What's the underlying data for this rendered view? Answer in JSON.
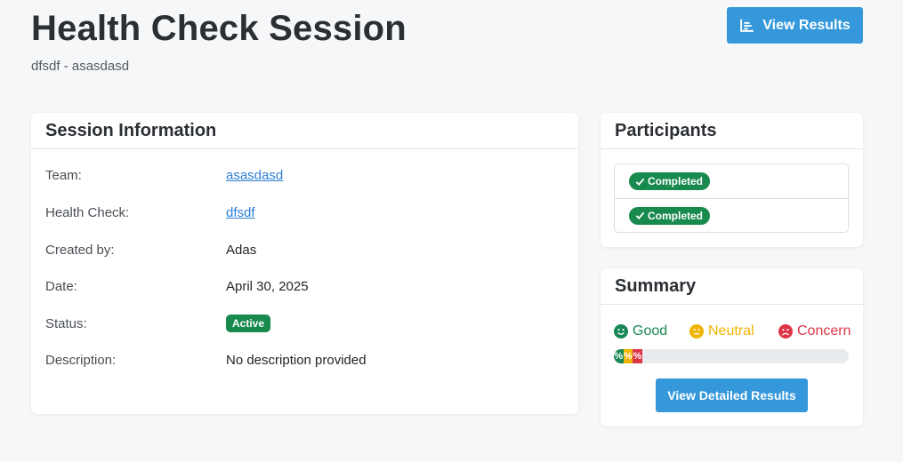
{
  "header": {
    "title": "Health Check Session",
    "subtitle": "dfsdf - asasdasd",
    "view_results_label": "View Results"
  },
  "session_info": {
    "heading": "Session Information",
    "rows": [
      {
        "label": "Team:",
        "value": "asasdasd",
        "type": "link"
      },
      {
        "label": "Health Check:",
        "value": "dfsdf",
        "type": "link"
      },
      {
        "label": "Created by:",
        "value": "Adas",
        "type": "text"
      },
      {
        "label": "Date:",
        "value": "April 30, 2025",
        "type": "text"
      },
      {
        "label": "Status:",
        "value": "Active",
        "type": "badge"
      },
      {
        "label": "Description:",
        "value": "No description provided",
        "type": "text"
      }
    ]
  },
  "participants": {
    "heading": "Participants",
    "items": [
      {
        "status": "Completed"
      },
      {
        "status": "Completed"
      }
    ]
  },
  "summary": {
    "heading": "Summary",
    "legend": [
      {
        "label": "Good",
        "color": "#198754",
        "icon": "smile-icon"
      },
      {
        "label": "Neutral",
        "color": "#f0b400",
        "icon": "neutral-face-icon"
      },
      {
        "label": "Concern",
        "color": "#dc3545",
        "icon": "frown-icon"
      }
    ],
    "progress": [
      {
        "text": "%",
        "color": "#198754",
        "fraction": 0.04
      },
      {
        "text": "%",
        "color": "#f0b400",
        "fraction": 0.04
      },
      {
        "text": "%",
        "color": "#dc3545",
        "fraction": 0.04
      }
    ],
    "detailed_button_label": "View Detailed Results"
  },
  "colors": {
    "primary": "#3498db",
    "success": "#198754",
    "link": "#2d7fd4"
  }
}
